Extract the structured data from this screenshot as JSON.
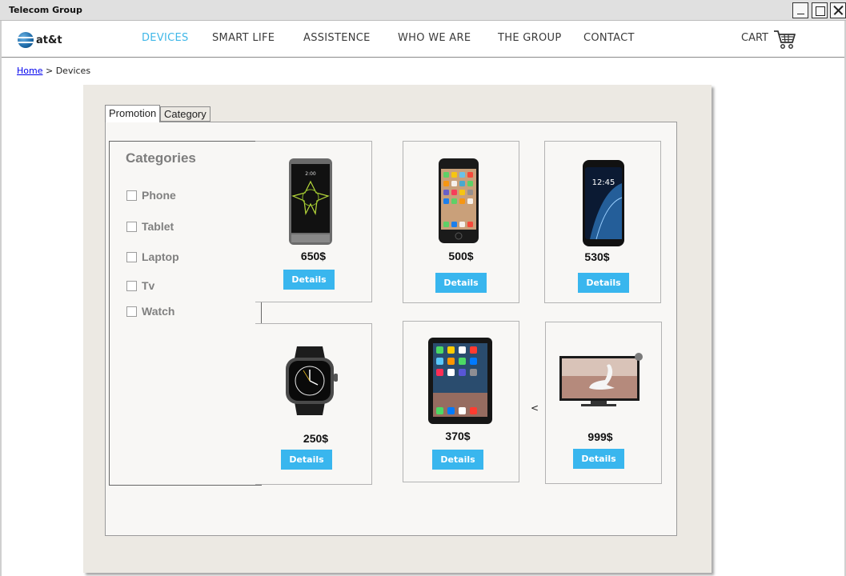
{
  "window": {
    "title": "Telecom Group"
  },
  "nav": {
    "brand": "at&t",
    "items": [
      "DEVICES",
      "SMART LIFE",
      "ASSISTENCE",
      "WHO WE ARE",
      "THE GROUP",
      "CONTACT"
    ],
    "active": "DEVICES",
    "cart_label": "CART"
  },
  "breadcrumb": {
    "home": "Home",
    "separator": ">",
    "current": "Devices"
  },
  "tabs": {
    "promotion": "Promotion",
    "category": "Category",
    "selected": "Promotion"
  },
  "categories": {
    "heading": "Categories",
    "items": [
      "Phone",
      "Tablet",
      "Laptop",
      "Tv",
      "Watch"
    ]
  },
  "products": [
    {
      "name": "phone-lg",
      "price": "650$",
      "button": "Details"
    },
    {
      "name": "iphone",
      "price": "500$",
      "button": "Details"
    },
    {
      "name": "galaxy",
      "price": "530$",
      "button": "Details"
    },
    {
      "name": "smartwatch",
      "price": "250$",
      "button": "Details"
    },
    {
      "name": "ipad",
      "price": "370$",
      "button": "Details"
    },
    {
      "name": "tv",
      "price": "999$",
      "button": "Details"
    }
  ],
  "misc": {
    "arrow": "<"
  },
  "colors": {
    "accent": "#39b6ee",
    "active_nav": "#3fb7e8",
    "panel_bg": "#ece9e3"
  }
}
